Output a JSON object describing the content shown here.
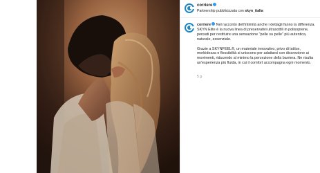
{
  "post": {
    "header": {
      "username": "corriere",
      "partnership_text": "Partnership pubblicizzata con",
      "partner_name": "skyn_italia"
    },
    "caption": {
      "username": "corriere",
      "paragraph1": "Nel racconto dell'intimità anche i dettagli fanno la differenza. SKYN Elite è la nuova linea di preservativi ultrasottili in polisoprene, pensati per restituire una sensazione \"pelle su pelle\" più autentica, naturale, essenziale.",
      "paragraph2": "Grazie a SKYNFEEL®, un materiale innovativo, privo di lattice, morbidezza e flessibilità si uniscono per adattarsi con discrezione ai movimenti, riducendo al minimo la percezione della barriera. Ne risulta un'esperienza più fluida, in cui il comfort accompagna ogni momento.",
      "timestamp": "5 g"
    },
    "icons": {
      "avatar": "corriere-logo-icon",
      "verified": "verified-badge-icon"
    },
    "colors": {
      "brand": "#1f88c2",
      "verified": "#3897f0",
      "muted": "#8e8e8e"
    }
  }
}
